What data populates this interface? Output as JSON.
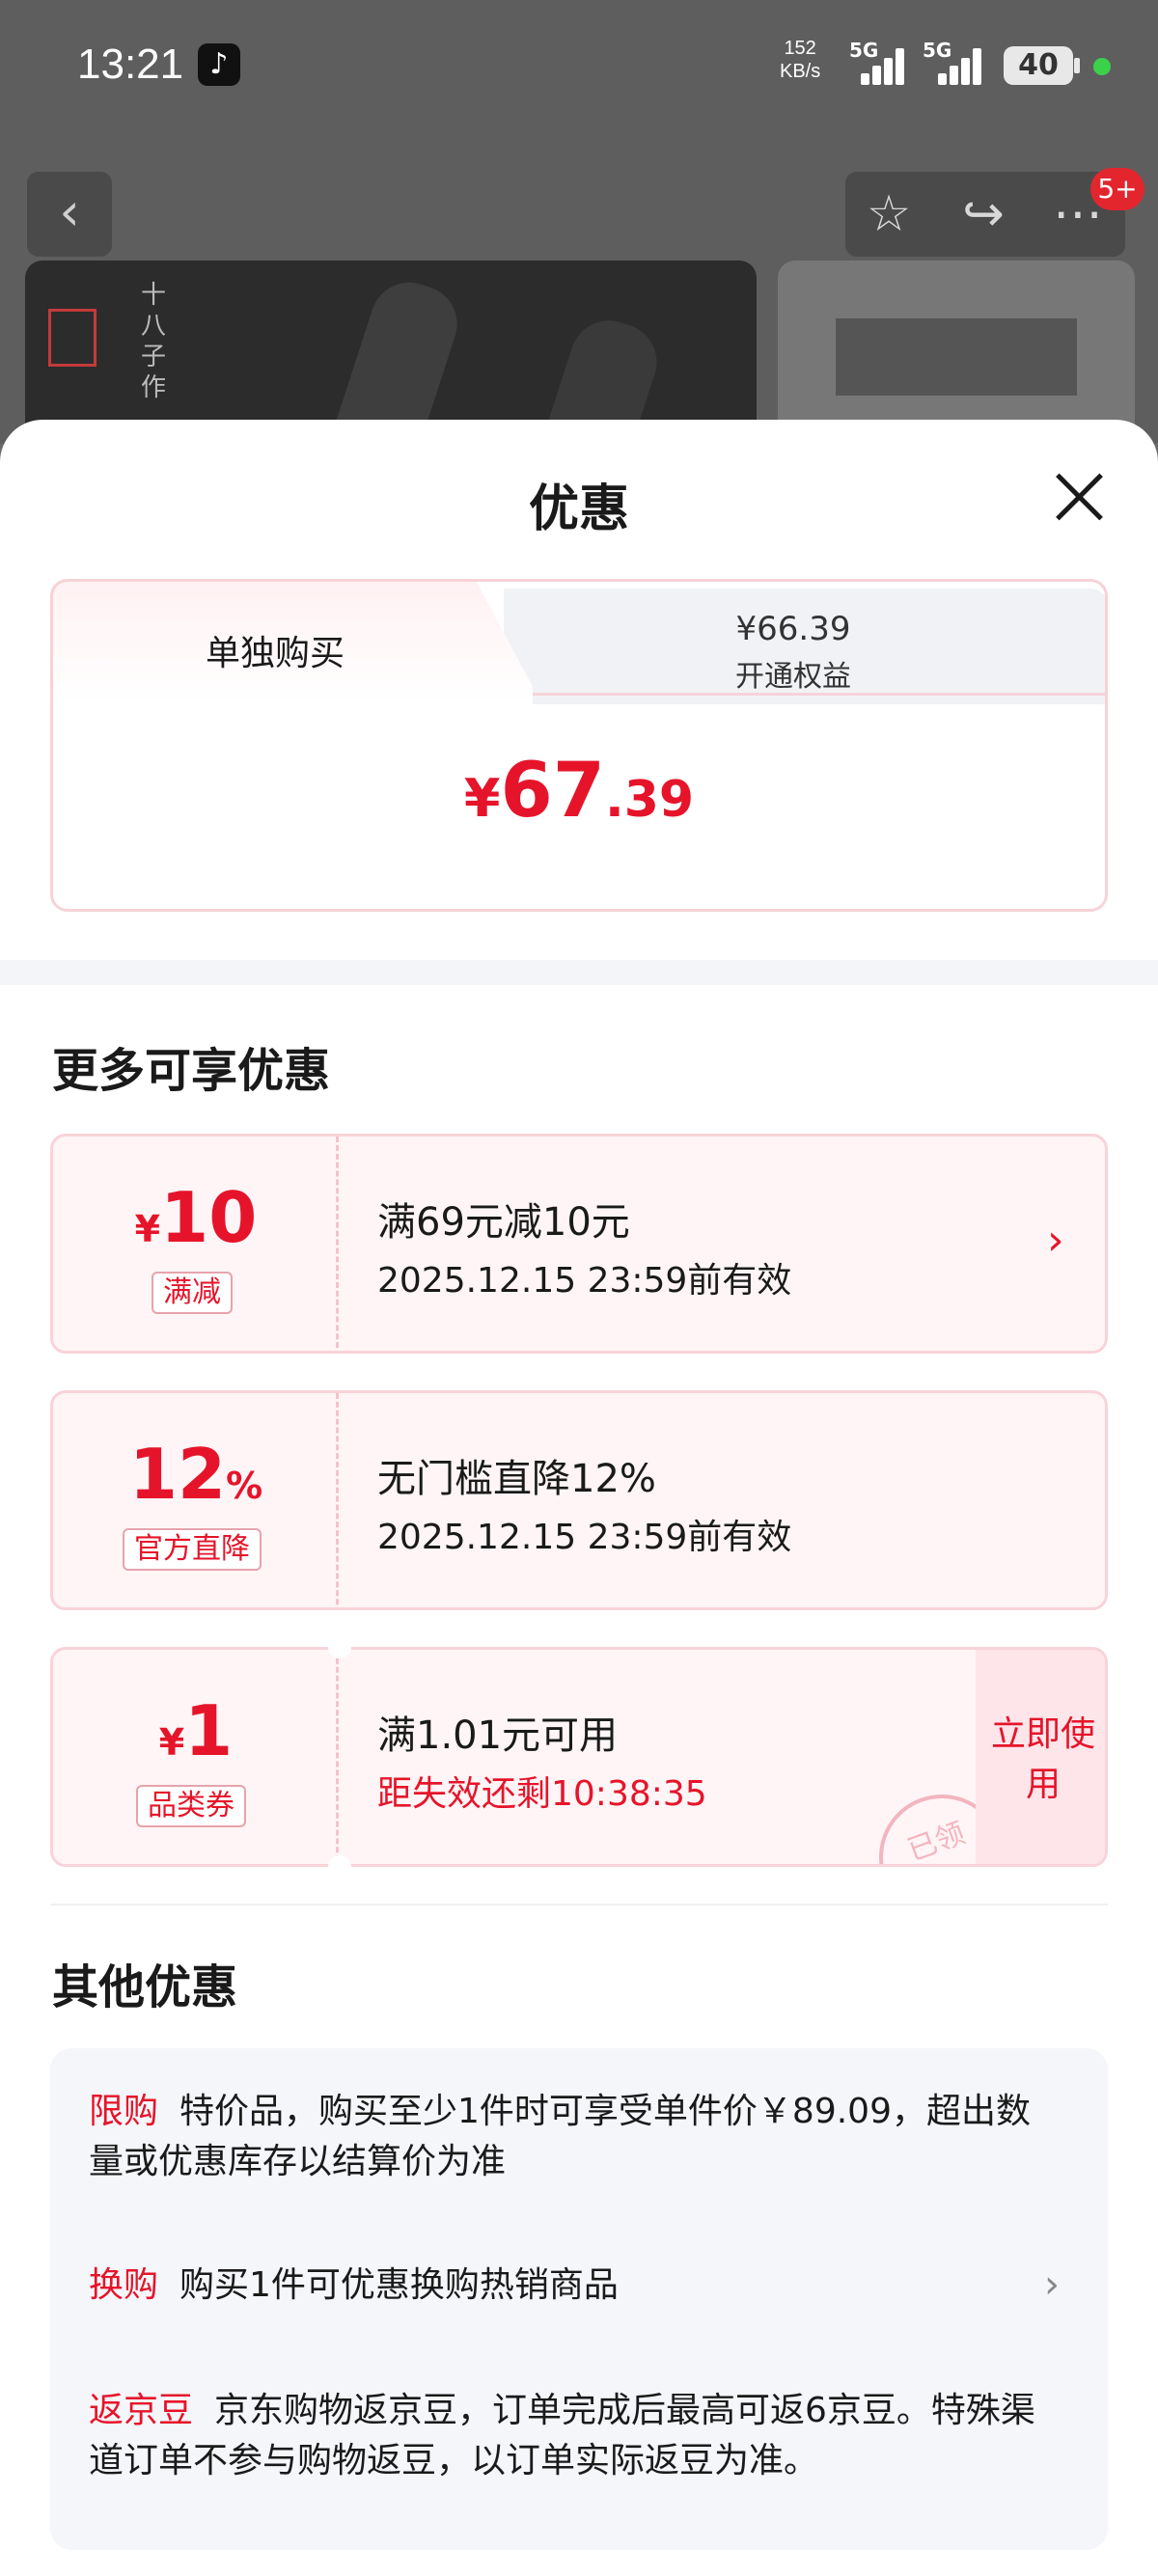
{
  "status_bar": {
    "time": "13:21",
    "net_speed_value": "152",
    "net_speed_unit": "KB/s",
    "sim1": "5G",
    "sim2": "5G",
    "battery": "40"
  },
  "background": {
    "badge": "5+",
    "brand_vertical": "十八子作"
  },
  "sheet": {
    "title": "优惠",
    "tabs": {
      "single_buy": "单独购买",
      "member_price": "¥66.39",
      "member_label": "开通权益"
    },
    "price": {
      "currency": "¥",
      "integer": "67",
      "decimal": ".39"
    }
  },
  "more_offers": {
    "title": "更多可享优惠",
    "coupons": [
      {
        "prefix": "¥",
        "amount": "10",
        "tag": "满减",
        "line1": "满69元减10元",
        "line2": "2025.12.15 23:59前有效"
      },
      {
        "amount": "12",
        "suffix": "%",
        "tag": "官方直降",
        "line1": "无门槛直降12%",
        "line2": "2025.12.15 23:59前有效"
      },
      {
        "prefix": "¥",
        "amount": "1",
        "tag": "品类券",
        "line1": "满1.01元可用",
        "line2": "距失效还剩10:38:35",
        "action": "立即使用",
        "stamp": "已领"
      }
    ]
  },
  "other_offers": {
    "title": "其他优惠",
    "items": [
      {
        "key": "限购",
        "text": "特价品，购买至少1件时可享受单件价￥89.09，超出数量或优惠库存以结算价为准"
      },
      {
        "key": "换购",
        "text": "购买1件可优惠换购热销商品"
      },
      {
        "key": "返京豆",
        "text": "京东购物返京豆，订单完成后最高可返6京豆。特殊渠道订单不参与购物返豆，以订单实际返豆为准。"
      }
    ]
  }
}
